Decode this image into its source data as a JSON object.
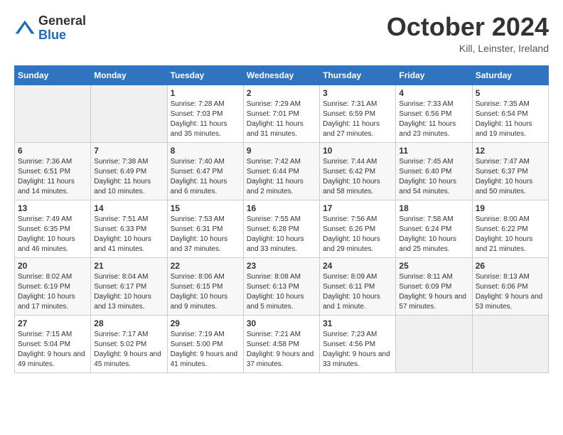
{
  "logo": {
    "general": "General",
    "blue": "Blue"
  },
  "title": "October 2024",
  "location": "Kill, Leinster, Ireland",
  "days_header": [
    "Sunday",
    "Monday",
    "Tuesday",
    "Wednesday",
    "Thursday",
    "Friday",
    "Saturday"
  ],
  "weeks": [
    [
      {
        "day": "",
        "sunrise": "",
        "sunset": "",
        "daylight": "",
        "empty": true
      },
      {
        "day": "",
        "sunrise": "",
        "sunset": "",
        "daylight": "",
        "empty": true
      },
      {
        "day": "1",
        "sunrise": "Sunrise: 7:28 AM",
        "sunset": "Sunset: 7:03 PM",
        "daylight": "Daylight: 11 hours and 35 minutes."
      },
      {
        "day": "2",
        "sunrise": "Sunrise: 7:29 AM",
        "sunset": "Sunset: 7:01 PM",
        "daylight": "Daylight: 11 hours and 31 minutes."
      },
      {
        "day": "3",
        "sunrise": "Sunrise: 7:31 AM",
        "sunset": "Sunset: 6:59 PM",
        "daylight": "Daylight: 11 hours and 27 minutes."
      },
      {
        "day": "4",
        "sunrise": "Sunrise: 7:33 AM",
        "sunset": "Sunset: 6:56 PM",
        "daylight": "Daylight: 11 hours and 23 minutes."
      },
      {
        "day": "5",
        "sunrise": "Sunrise: 7:35 AM",
        "sunset": "Sunset: 6:54 PM",
        "daylight": "Daylight: 11 hours and 19 minutes."
      }
    ],
    [
      {
        "day": "6",
        "sunrise": "Sunrise: 7:36 AM",
        "sunset": "Sunset: 6:51 PM",
        "daylight": "Daylight: 11 hours and 14 minutes."
      },
      {
        "day": "7",
        "sunrise": "Sunrise: 7:38 AM",
        "sunset": "Sunset: 6:49 PM",
        "daylight": "Daylight: 11 hours and 10 minutes."
      },
      {
        "day": "8",
        "sunrise": "Sunrise: 7:40 AM",
        "sunset": "Sunset: 6:47 PM",
        "daylight": "Daylight: 11 hours and 6 minutes."
      },
      {
        "day": "9",
        "sunrise": "Sunrise: 7:42 AM",
        "sunset": "Sunset: 6:44 PM",
        "daylight": "Daylight: 11 hours and 2 minutes."
      },
      {
        "day": "10",
        "sunrise": "Sunrise: 7:44 AM",
        "sunset": "Sunset: 6:42 PM",
        "daylight": "Daylight: 10 hours and 58 minutes."
      },
      {
        "day": "11",
        "sunrise": "Sunrise: 7:45 AM",
        "sunset": "Sunset: 6:40 PM",
        "daylight": "Daylight: 10 hours and 54 minutes."
      },
      {
        "day": "12",
        "sunrise": "Sunrise: 7:47 AM",
        "sunset": "Sunset: 6:37 PM",
        "daylight": "Daylight: 10 hours and 50 minutes."
      }
    ],
    [
      {
        "day": "13",
        "sunrise": "Sunrise: 7:49 AM",
        "sunset": "Sunset: 6:35 PM",
        "daylight": "Daylight: 10 hours and 46 minutes."
      },
      {
        "day": "14",
        "sunrise": "Sunrise: 7:51 AM",
        "sunset": "Sunset: 6:33 PM",
        "daylight": "Daylight: 10 hours and 41 minutes."
      },
      {
        "day": "15",
        "sunrise": "Sunrise: 7:53 AM",
        "sunset": "Sunset: 6:31 PM",
        "daylight": "Daylight: 10 hours and 37 minutes."
      },
      {
        "day": "16",
        "sunrise": "Sunrise: 7:55 AM",
        "sunset": "Sunset: 6:28 PM",
        "daylight": "Daylight: 10 hours and 33 minutes."
      },
      {
        "day": "17",
        "sunrise": "Sunrise: 7:56 AM",
        "sunset": "Sunset: 6:26 PM",
        "daylight": "Daylight: 10 hours and 29 minutes."
      },
      {
        "day": "18",
        "sunrise": "Sunrise: 7:58 AM",
        "sunset": "Sunset: 6:24 PM",
        "daylight": "Daylight: 10 hours and 25 minutes."
      },
      {
        "day": "19",
        "sunrise": "Sunrise: 8:00 AM",
        "sunset": "Sunset: 6:22 PM",
        "daylight": "Daylight: 10 hours and 21 minutes."
      }
    ],
    [
      {
        "day": "20",
        "sunrise": "Sunrise: 8:02 AM",
        "sunset": "Sunset: 6:19 PM",
        "daylight": "Daylight: 10 hours and 17 minutes."
      },
      {
        "day": "21",
        "sunrise": "Sunrise: 8:04 AM",
        "sunset": "Sunset: 6:17 PM",
        "daylight": "Daylight: 10 hours and 13 minutes."
      },
      {
        "day": "22",
        "sunrise": "Sunrise: 8:06 AM",
        "sunset": "Sunset: 6:15 PM",
        "daylight": "Daylight: 10 hours and 9 minutes."
      },
      {
        "day": "23",
        "sunrise": "Sunrise: 8:08 AM",
        "sunset": "Sunset: 6:13 PM",
        "daylight": "Daylight: 10 hours and 5 minutes."
      },
      {
        "day": "24",
        "sunrise": "Sunrise: 8:09 AM",
        "sunset": "Sunset: 6:11 PM",
        "daylight": "Daylight: 10 hours and 1 minute."
      },
      {
        "day": "25",
        "sunrise": "Sunrise: 8:11 AM",
        "sunset": "Sunset: 6:09 PM",
        "daylight": "Daylight: 9 hours and 57 minutes."
      },
      {
        "day": "26",
        "sunrise": "Sunrise: 8:13 AM",
        "sunset": "Sunset: 6:06 PM",
        "daylight": "Daylight: 9 hours and 53 minutes."
      }
    ],
    [
      {
        "day": "27",
        "sunrise": "Sunrise: 7:15 AM",
        "sunset": "Sunset: 5:04 PM",
        "daylight": "Daylight: 9 hours and 49 minutes."
      },
      {
        "day": "28",
        "sunrise": "Sunrise: 7:17 AM",
        "sunset": "Sunset: 5:02 PM",
        "daylight": "Daylight: 9 hours and 45 minutes."
      },
      {
        "day": "29",
        "sunrise": "Sunrise: 7:19 AM",
        "sunset": "Sunset: 5:00 PM",
        "daylight": "Daylight: 9 hours and 41 minutes."
      },
      {
        "day": "30",
        "sunrise": "Sunrise: 7:21 AM",
        "sunset": "Sunset: 4:58 PM",
        "daylight": "Daylight: 9 hours and 37 minutes."
      },
      {
        "day": "31",
        "sunrise": "Sunrise: 7:23 AM",
        "sunset": "Sunset: 4:56 PM",
        "daylight": "Daylight: 9 hours and 33 minutes."
      },
      {
        "day": "",
        "sunrise": "",
        "sunset": "",
        "daylight": "",
        "empty": true
      },
      {
        "day": "",
        "sunrise": "",
        "sunset": "",
        "daylight": "",
        "empty": true
      }
    ]
  ]
}
